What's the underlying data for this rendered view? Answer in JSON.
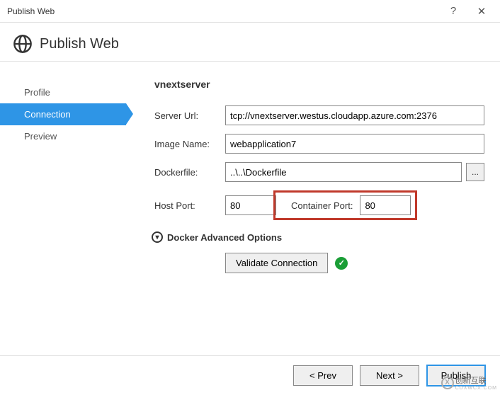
{
  "window": {
    "title": "Publish Web",
    "help": "?",
    "close": "✕"
  },
  "header": {
    "title": "Publish Web"
  },
  "sidebar": {
    "items": [
      {
        "label": "Profile"
      },
      {
        "label": "Connection"
      },
      {
        "label": "Preview"
      }
    ]
  },
  "content": {
    "title": "vnextserver",
    "server_url_label": "Server Url:",
    "server_url_value": "tcp://vnextserver.westus.cloudapp.azure.com:2376",
    "image_name_label": "Image Name:",
    "image_name_value": "webapplication7",
    "dockerfile_label": "Dockerfile:",
    "dockerfile_value": "..\\..\\Dockerfile",
    "browse_label": "...",
    "host_port_label": "Host Port:",
    "host_port_value": "80",
    "container_port_label": "Container Port:",
    "container_port_value": "80",
    "advanced_label": "Docker Advanced Options",
    "validate_label": "Validate Connection"
  },
  "footer": {
    "prev": "< Prev",
    "next": "Next >",
    "publish": "Publish"
  },
  "watermark": {
    "brand": "创新互联",
    "sub": "CDXWCX.COM"
  }
}
